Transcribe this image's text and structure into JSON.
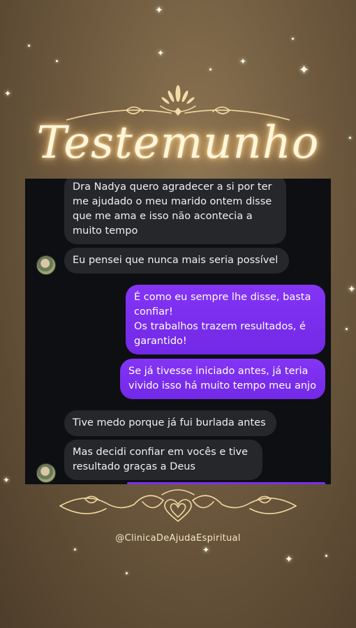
{
  "title": "Testemunho",
  "handle": "@ClinicaDeAjudaEspiritual",
  "colors": {
    "accent": "#7b2ff0",
    "chat_bg": "#0e0f12",
    "incoming_bubble": "#25272b",
    "gold": "#f0d7a0"
  },
  "messages": [
    {
      "side": "incoming",
      "text": "Dra Nadya quero agradecer a si por ter\nme ajudado o meu marido ontem disse\nque me ama e isso não acontecia a\nmuito tempo"
    },
    {
      "side": "incoming",
      "text": "Eu pensei que nunca mais seria possível"
    },
    {
      "side": "outgoing",
      "text": "É como eu sempre lhe disse, basta\nconfiar!\nOs trabalhos trazem resultados, é\ngarantido!"
    },
    {
      "side": "outgoing",
      "text": "Se já tivesse iniciado antes, já teria\nvivido isso há muito tempo meu anjo"
    },
    {
      "side": "incoming",
      "text": "Tive medo porque já fui burlada antes"
    },
    {
      "side": "incoming",
      "text": "Mas decidi confiar em vocês e tive\nresultado graças a Deus"
    }
  ]
}
